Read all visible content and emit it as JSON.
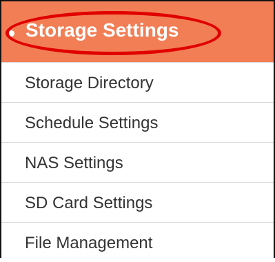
{
  "menu": {
    "header": {
      "label": "Storage Settings",
      "bullet": "•",
      "color": "#f27e55",
      "highlight_color": "#e00000"
    },
    "items": [
      {
        "label": "Storage Directory"
      },
      {
        "label": "Schedule Settings"
      },
      {
        "label": "NAS Settings"
      },
      {
        "label": "SD Card Settings"
      },
      {
        "label": "File Management"
      }
    ]
  }
}
